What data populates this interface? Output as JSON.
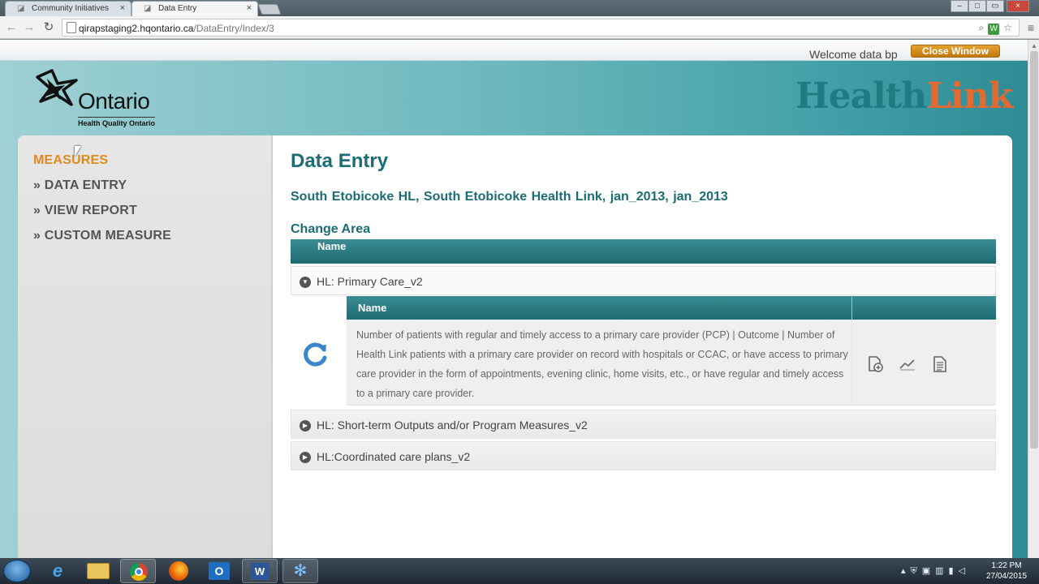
{
  "browser": {
    "tabs": [
      {
        "title": "Community Initiatives",
        "close": "×"
      },
      {
        "title": "Data Entry",
        "close": "×"
      }
    ],
    "window_controls": {
      "minimize": "–",
      "maximize": "□",
      "close": "×"
    },
    "nav": {
      "back": "←",
      "forward": "→",
      "reload": "↻"
    },
    "url_host": "qirapstaging2.hqontario.ca",
    "url_path": "/DataEntry/Index/3",
    "omnibox_icons": {
      "zoom": "⌕",
      "extension": "W",
      "star": "☆"
    },
    "menu": "≡"
  },
  "header": {
    "welcome": "Welcome data bp",
    "close_window": "Close Window",
    "logo_name": "Ontario",
    "logo_sub": "Health Quality Ontario",
    "brand_part1": "Health",
    "brand_part2": "Link"
  },
  "sidebar": {
    "items": [
      {
        "label": "MEASURES",
        "active": true
      },
      {
        "label": "» DATA ENTRY",
        "active": false
      },
      {
        "label": "» VIEW REPORT",
        "active": false
      },
      {
        "label": "» CUSTOM MEASURE",
        "active": false
      }
    ]
  },
  "main": {
    "title": "Data Entry",
    "context": "South Etobicoke HL,   South Etobicoke Health Link,   jan_2013,   jan_2013",
    "change_area": "Change Area",
    "grid_header": "Name",
    "groups": [
      {
        "label": "HL: Primary Care_v2",
        "expanded": true
      },
      {
        "label": "HL: Short-term Outputs and/or Program Measures_v2",
        "expanded": false
      },
      {
        "label": "HL:Coordinated care plans_v2",
        "expanded": false
      }
    ],
    "sub_header": "Name",
    "measure_description": "Number of patients with regular and timely access to a primary care provider (PCP) | Outcome | Number of Health Link patients with a primary care provider on record with hospitals or CCAC, or have access to primary care provider in the form of appointments, evening clinic, home visits, etc., or have regular and timely access to a primary care provider.",
    "action_icons": [
      "add-document-icon",
      "line-chart-icon",
      "report-document-icon"
    ]
  },
  "colors": {
    "accent_teal": "#1c6c76",
    "accent_orange": "#e08a1e",
    "header_bar": "#1f6b73"
  }
}
